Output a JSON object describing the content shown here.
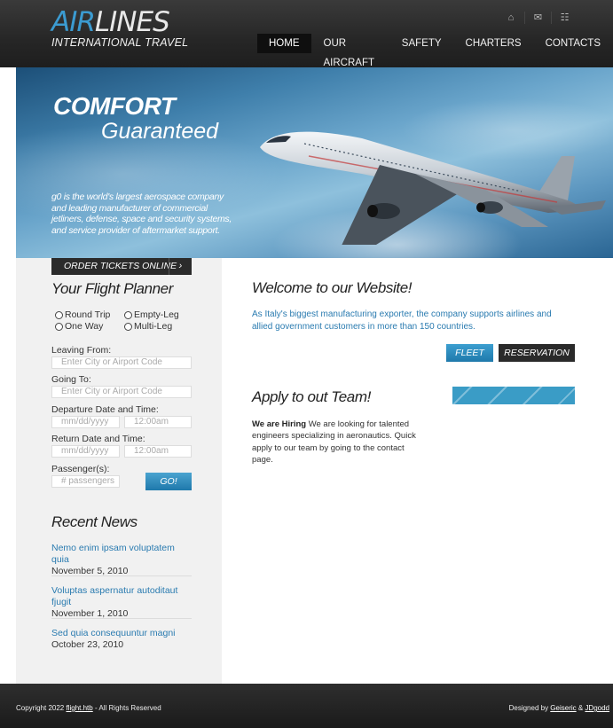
{
  "header": {
    "logo_part1": "AIR",
    "logo_part2": "LINES",
    "logo_sub": "INTERNATIONAL TRAVEL",
    "icons": [
      "home-icon",
      "mail-icon",
      "sitemap-icon"
    ],
    "nav": [
      "HOME",
      "OUR AIRCRAFT",
      "SAFETY",
      "CHARTERS",
      "CONTACTS"
    ],
    "active_nav": "HOME"
  },
  "hero": {
    "title1": "COMFORT",
    "title2": "Guaranteed",
    "text": "g0 is the world's largest aerospace company and leading manufacturer of commercial jetliners, defense, space and security systems, and service provider of aftermarket support."
  },
  "planner": {
    "order_label": "ORDER TICKETS ONLINE",
    "order_arrow": "›",
    "title": "Your Flight Planner",
    "trip_types": [
      "Round Trip",
      "Empty-Leg",
      "One Way",
      "Multi-Leg"
    ],
    "leaving_label": "Leaving From:",
    "leaving_placeholder": "Enter City or Airport Code",
    "going_label": "Going To:",
    "going_placeholder": "Enter City or Airport Code",
    "departure_label": "Departure Date and Time:",
    "return_label": "Return Date and Time:",
    "date_placeholder": "mm/dd/yyyy",
    "time_placeholder": "12:00am",
    "passengers_label": "Passenger(s):",
    "passengers_placeholder": "# passengers",
    "go_label": "GO!"
  },
  "news": {
    "title": "Recent News",
    "items": [
      {
        "title": "Nemo enim ipsam voluptatem quia",
        "date": "November 5, 2010"
      },
      {
        "title": "Voluptas aspernatur autoditaut fjugit",
        "date": "November 1, 2010"
      },
      {
        "title": "Sed quia consequuntur magni",
        "date": "October 23, 2010"
      }
    ]
  },
  "main": {
    "welcome_title": "Welcome to our Website!",
    "welcome_text": "As Italy's biggest manufacturing exporter, the company supports airlines and allied government customers in more than 150 countries.",
    "fleet_label": "FLEET",
    "reservation_label": "RESERVATION",
    "apply_title": "Apply to out Team!",
    "apply_bold": "We are Hiring",
    "apply_text": " We are looking for talented engineers specializing in aeronautics. Quick apply to our team by going to the contact page.",
    "progress_fraction": 1.0,
    "progress_color": "#3a9cc6"
  },
  "footer": {
    "copy_prefix": "Copyright 2022 ",
    "copy_link": "flight.htb",
    "copy_suffix": " - All Rights Reserved",
    "designed_prefix": "Designed by ",
    "designer1": "Geiseric",
    "amp": " & ",
    "designer2": "JDgodd"
  }
}
